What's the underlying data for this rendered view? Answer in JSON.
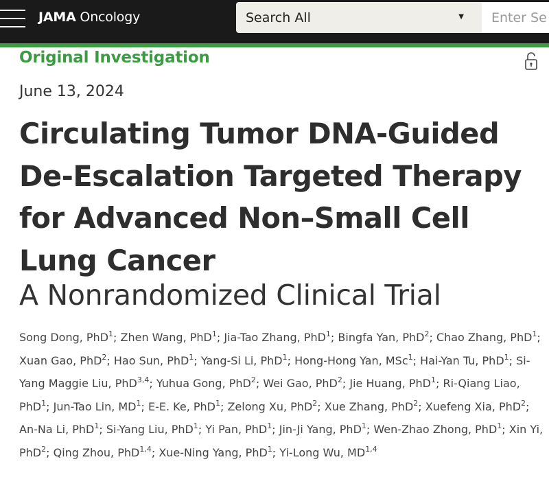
{
  "header": {
    "brand_bold": "JAMA",
    "brand_rest": " Oncology",
    "search_scope": "Search All",
    "search_placeholder": "Enter Search Term"
  },
  "article": {
    "category": "Original Investigation",
    "date": "June 13, 2024",
    "title": "Circulating Tumor DNA-Guided De-Escalation Targeted Therapy for Advanced Non–Small Cell Lung Cancer",
    "subtitle": "A Nonrandomized Clinical Trial"
  },
  "authors": [
    {
      "name": "Song Dong, PhD",
      "aff": "1"
    },
    {
      "name": "Zhen Wang, PhD",
      "aff": "1"
    },
    {
      "name": "Jia-Tao Zhang, PhD",
      "aff": "1"
    },
    {
      "name": "Bingfa Yan, PhD",
      "aff": "2"
    },
    {
      "name": "Chao Zhang, PhD",
      "aff": "1"
    },
    {
      "name": "Xuan Gao, PhD",
      "aff": "2"
    },
    {
      "name": "Hao Sun, PhD",
      "aff": "1"
    },
    {
      "name": "Yang-Si Li, PhD",
      "aff": "1"
    },
    {
      "name": "Hong-Hong Yan, MSc",
      "aff": "1"
    },
    {
      "name": "Hai-Yan Tu, PhD",
      "aff": "1"
    },
    {
      "name": "Si-Yang Maggie Liu, PhD",
      "aff": "3,4"
    },
    {
      "name": "Yuhua Gong, PhD",
      "aff": "2"
    },
    {
      "name": "Wei Gao, PhD",
      "aff": "2"
    },
    {
      "name": "Jie Huang, PhD",
      "aff": "1"
    },
    {
      "name": "Ri-Qiang Liao, PhD",
      "aff": "1"
    },
    {
      "name": "Jun-Tao Lin, MD",
      "aff": "1"
    },
    {
      "name": "E-E. Ke, PhD",
      "aff": "1"
    },
    {
      "name": "Zelong Xu, PhD",
      "aff": "2"
    },
    {
      "name": "Xue Zhang, PhD",
      "aff": "2"
    },
    {
      "name": "Xuefeng Xia, PhD",
      "aff": "2"
    },
    {
      "name": "An-Na Li, PhD",
      "aff": "1"
    },
    {
      "name": "Si-Yang Liu, PhD",
      "aff": "1"
    },
    {
      "name": "Yi Pan, PhD",
      "aff": "1"
    },
    {
      "name": "Jin-Ji Yang, PhD",
      "aff": "1"
    },
    {
      "name": "Wen-Zhao Zhong, PhD",
      "aff": "1"
    },
    {
      "name": "Xin Yi, PhD",
      "aff": "2"
    },
    {
      "name": "Qing Zhou, PhD",
      "aff": "1,4"
    },
    {
      "name": "Xue-Ning Yang, PhD",
      "aff": "1"
    },
    {
      "name": "Yi-Long Wu, MD",
      "aff": "1,4"
    }
  ],
  "icons": {
    "menu": "hamburger-menu-icon",
    "caret": "chevron-down-icon",
    "lock": "unlocked-padlock-icon"
  },
  "colors": {
    "header_bg": "#1a1a1a",
    "accent_green": "#3c9a43",
    "search_bg": "#efeee8"
  }
}
